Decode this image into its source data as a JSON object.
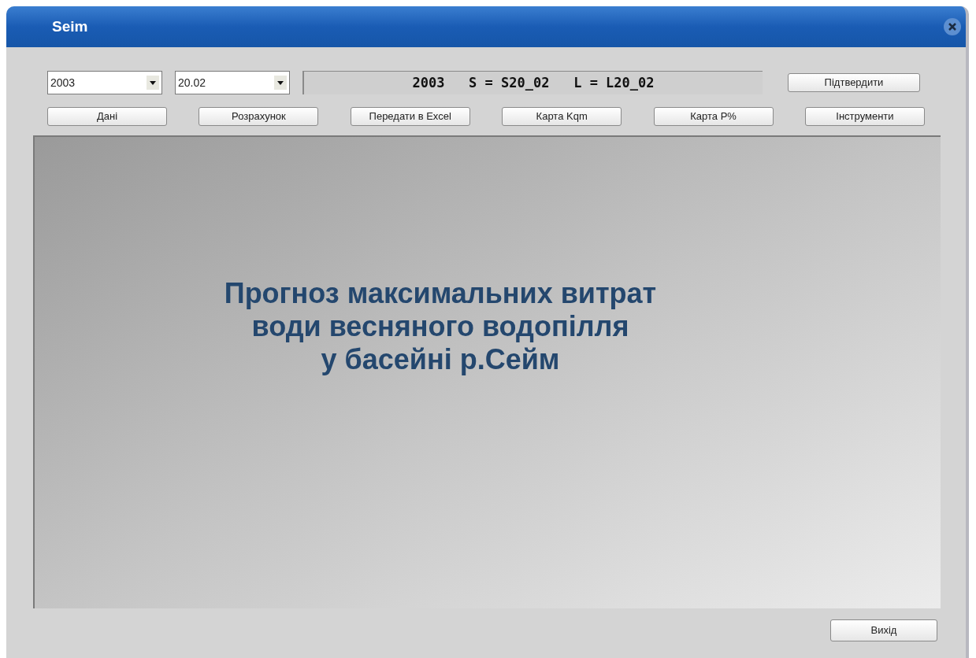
{
  "window": {
    "title": "Seim"
  },
  "selectors": [
    {
      "value": "2003"
    },
    {
      "value": "20.02"
    }
  ],
  "info": "2003   S = S20_02   L = L20_02",
  "confirm_button": "Підтвердити",
  "toolbar": [
    "Дані",
    "Розрахунок",
    "Передати в Excel",
    "Карта Kqm",
    "Карта P%",
    "Інструменти"
  ],
  "heading": [
    "Прогноз максимальних витрат",
    "води весняного водопілля",
    "у басейні р.Сейм"
  ],
  "exit_button": "Вихід"
}
